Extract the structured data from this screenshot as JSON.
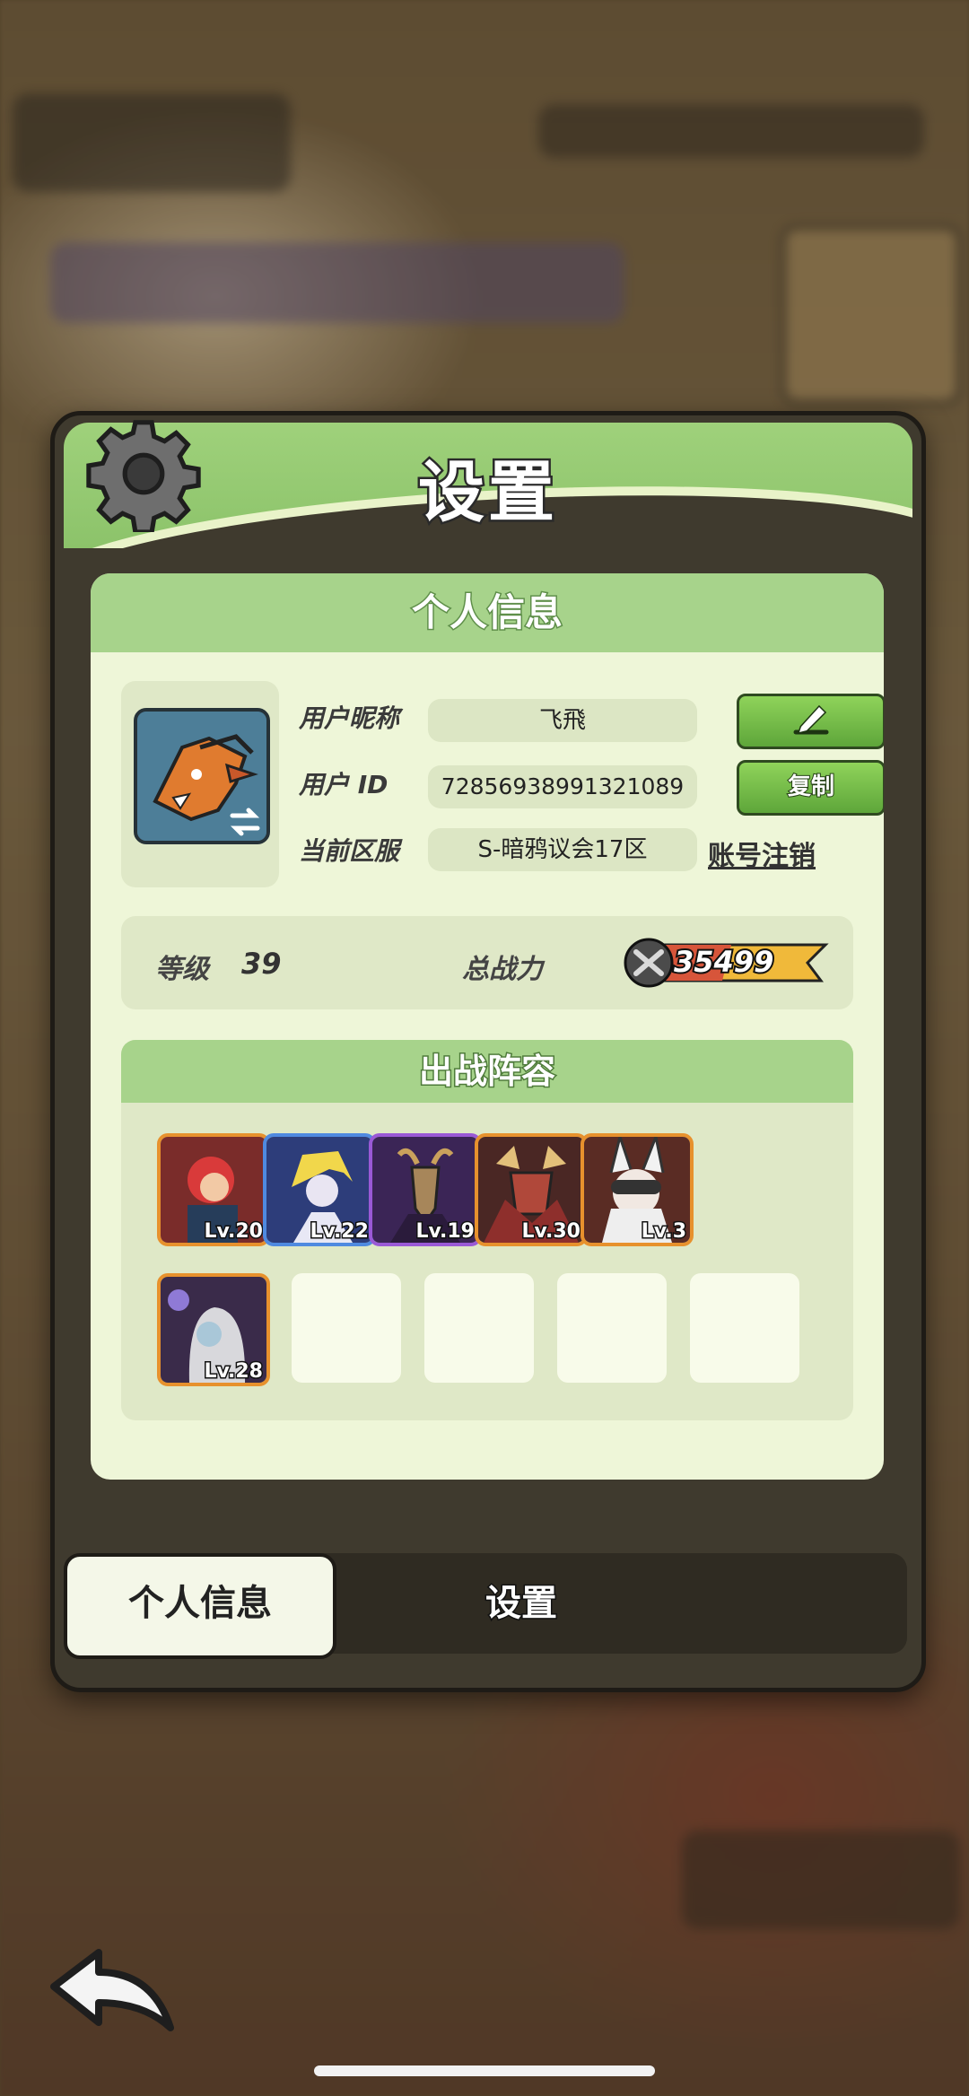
{
  "dialog": {
    "title": "设置",
    "panel_title": "个人信息",
    "fields": {
      "nickname_label": "用户昵称",
      "nickname_value": "飞飛",
      "id_label": "用户 ID",
      "id_value": "7285693899132108",
      "id_value_full": "72856938991321089",
      "server_label": "当前区服",
      "server_value": "S-暗鸦议会17区",
      "copy_button": "复制",
      "delete_account_link": "账号注销"
    },
    "stats": {
      "level_label": "等级",
      "level_value": "39",
      "power_label": "总战力",
      "power_value": "35499"
    },
    "lineup": {
      "title": "出战阵容",
      "heroes": [
        {
          "level": "Lv.20",
          "frame": "orange"
        },
        {
          "level": "Lv.22",
          "frame": "blue"
        },
        {
          "level": "Lv.19",
          "frame": "purple"
        },
        {
          "level": "Lv.30",
          "frame": "orange"
        },
        {
          "level": "Lv.3",
          "frame": "orange"
        },
        {
          "level": "Lv.28",
          "frame": "orange"
        }
      ],
      "empty_slots": 4
    },
    "tabs": [
      {
        "label": "个人信息",
        "active": true
      },
      {
        "label": "设置",
        "active": false
      }
    ]
  },
  "icons": {
    "gear": "gear-icon",
    "edit": "pencil-icon",
    "swap": "swap-icon",
    "back": "back-arrow-icon",
    "power": "crossed-swords-icon"
  },
  "colors": {
    "header_green": "#9fd17b",
    "panel_bg": "#eef6d8",
    "button_green": "#5ea63a",
    "dialog_frame": "#3f3a2e"
  }
}
